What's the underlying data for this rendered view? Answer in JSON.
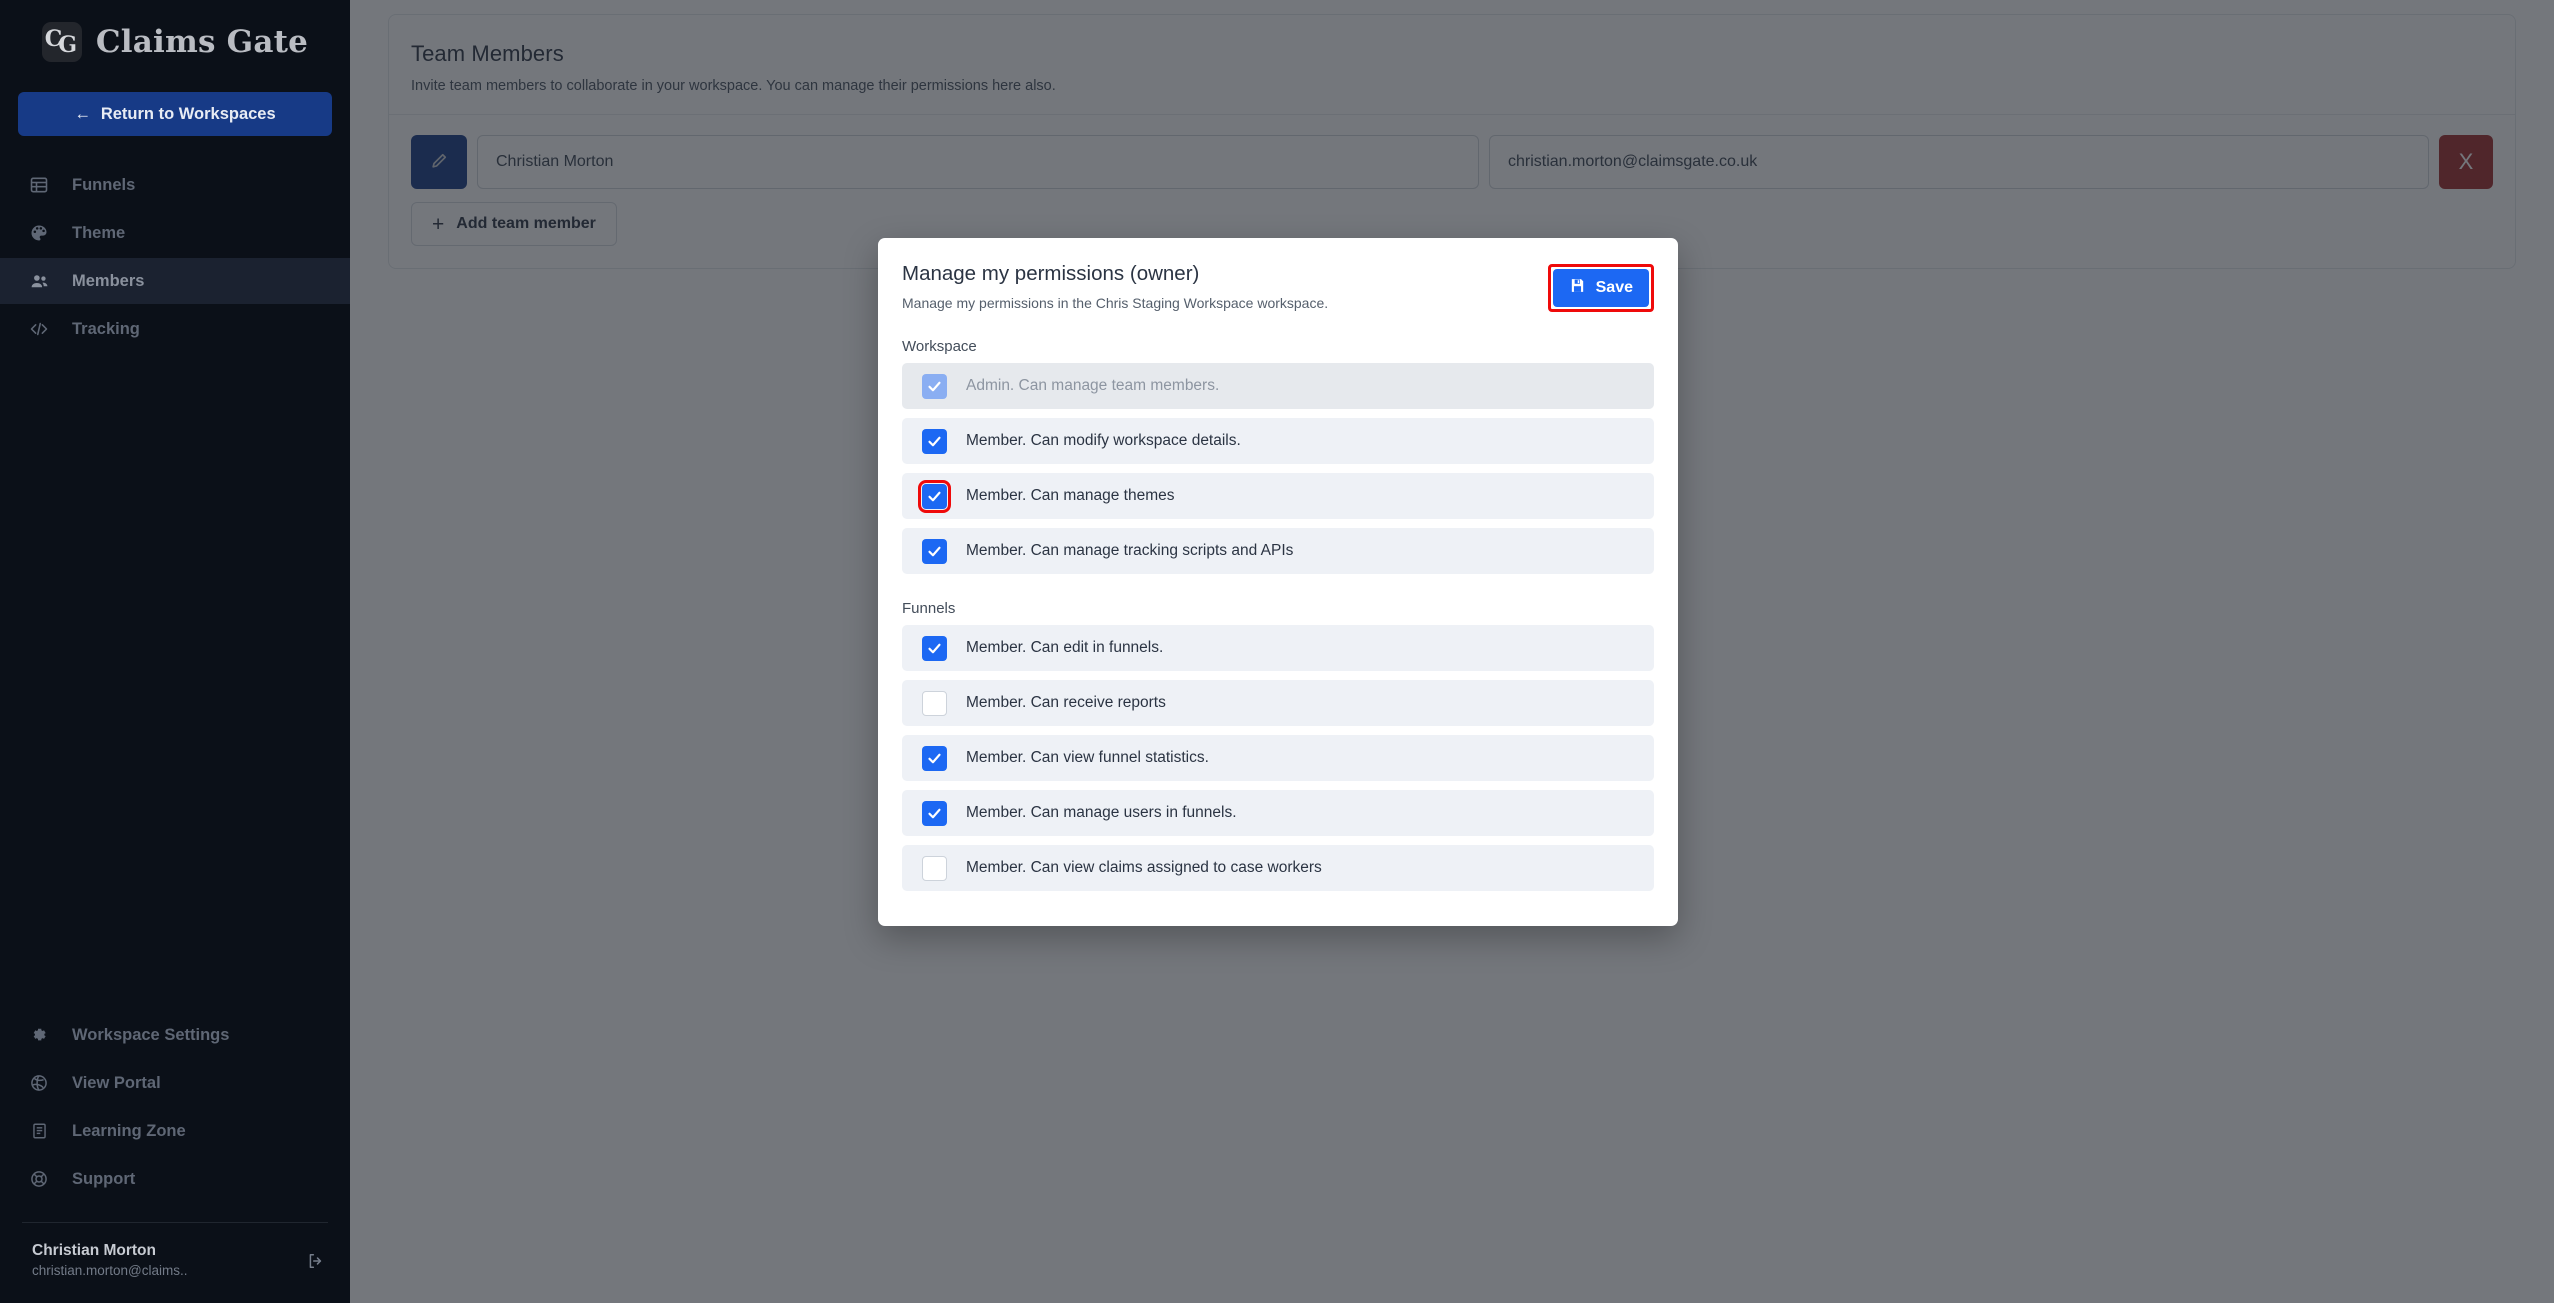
{
  "sidebar": {
    "brand": {
      "mark_c": "C",
      "mark_g": "G",
      "name": "Claims Gate"
    },
    "return_button": {
      "label": "Return to Workspaces",
      "arrow": "←",
      "icon": "arrow-left-icon"
    },
    "nav_top": [
      {
        "label": "Funnels",
        "icon": "table-icon",
        "active": false
      },
      {
        "label": "Theme",
        "icon": "palette-icon",
        "active": false
      },
      {
        "label": "Members",
        "icon": "people-icon",
        "active": true
      },
      {
        "label": "Tracking",
        "icon": "code-icon",
        "active": false
      }
    ],
    "nav_bottom": [
      {
        "label": "Workspace Settings",
        "icon": "gear-icon"
      },
      {
        "label": "View Portal",
        "icon": "globe-icon"
      },
      {
        "label": "Learning Zone",
        "icon": "book-icon"
      },
      {
        "label": "Support",
        "icon": "lifebuoy-icon"
      }
    ],
    "user": {
      "name": "Christian Morton",
      "email": "christian.morton@claims..",
      "logout_icon": "logout-icon"
    }
  },
  "main": {
    "card": {
      "title": "Team Members",
      "subtitle": "Invite team members to collaborate in your workspace. You can manage their permissions here also.",
      "member": {
        "edit_icon": "pencil-icon",
        "name_value": "Christian Morton",
        "name_placeholder": "Name",
        "email_value": "christian.morton@claimsgate.co.uk",
        "email_placeholder": "Email",
        "delete_label": "X",
        "delete_icon": "close-icon"
      },
      "add_button": {
        "label": "Add team member",
        "plus": "+",
        "icon": "plus-icon"
      }
    }
  },
  "modal": {
    "title": "Manage my permissions (owner)",
    "subtitle": "Manage my permissions in the Chris Staging Workspace workspace.",
    "save_button": {
      "label": "Save",
      "icon": "floppy-save-icon",
      "highlighted": true
    },
    "sections": [
      {
        "label": "Workspace",
        "items": [
          {
            "label": "Admin. Can manage team members.",
            "checked": true,
            "disabled": true,
            "highlighted": false
          },
          {
            "label": "Member. Can modify workspace details.",
            "checked": true,
            "disabled": false,
            "highlighted": false
          },
          {
            "label": "Member. Can manage themes",
            "checked": true,
            "disabled": false,
            "highlighted": true
          },
          {
            "label": "Member. Can manage tracking scripts and APIs",
            "checked": true,
            "disabled": false,
            "highlighted": false
          }
        ]
      },
      {
        "label": "Funnels",
        "items": [
          {
            "label": "Member. Can edit in funnels.",
            "checked": true,
            "disabled": false,
            "highlighted": false
          },
          {
            "label": "Member. Can receive reports",
            "checked": false,
            "disabled": false,
            "highlighted": false
          },
          {
            "label": "Member. Can view funnel statistics.",
            "checked": true,
            "disabled": false,
            "highlighted": false
          },
          {
            "label": "Member. Can manage users in funnels.",
            "checked": true,
            "disabled": false,
            "highlighted": false
          },
          {
            "label": "Member. Can view claims assigned to case workers",
            "checked": false,
            "disabled": false,
            "highlighted": false
          }
        ]
      }
    ]
  },
  "colors": {
    "sidebar_bg": "#0b1018",
    "accent_blue": "#173a86",
    "checkbox_blue": "#1c68f3",
    "danger_red": "#a02c2c",
    "highlight_red": "#ef0a0a",
    "row_bg": "#eef1f6",
    "row_bg_disabled": "#e6e9ed"
  }
}
